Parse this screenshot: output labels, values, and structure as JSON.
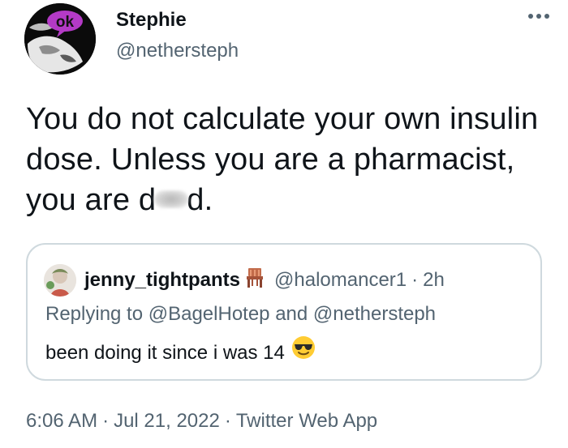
{
  "author": {
    "name": "Stephie",
    "handle": "@nethersteph",
    "avatar_badge": "ok"
  },
  "tweet": {
    "text_before_blur": "You do not calculate your own insulin dose. Unless you are a pharmacist, you are d",
    "text_after_blur": "d."
  },
  "quoted": {
    "name": "jenny_tightpants",
    "name_icon": "chair-emoji",
    "handle": "@halomancer1",
    "separator": "·",
    "time": "2h",
    "replying": "Replying to @BagelHotep and @nethersteph",
    "text": "been doing it since i was 14",
    "emoji": "sunglasses-emoji"
  },
  "footer": {
    "time": "6:06 AM",
    "sep1": "·",
    "date": "Jul 21, 2022",
    "sep2": "·",
    "source": "Twitter Web App"
  },
  "colors": {
    "text": "#0f1419",
    "secondary": "#536471",
    "border": "#cfd9de",
    "badge_purple": "#b43ac6"
  }
}
